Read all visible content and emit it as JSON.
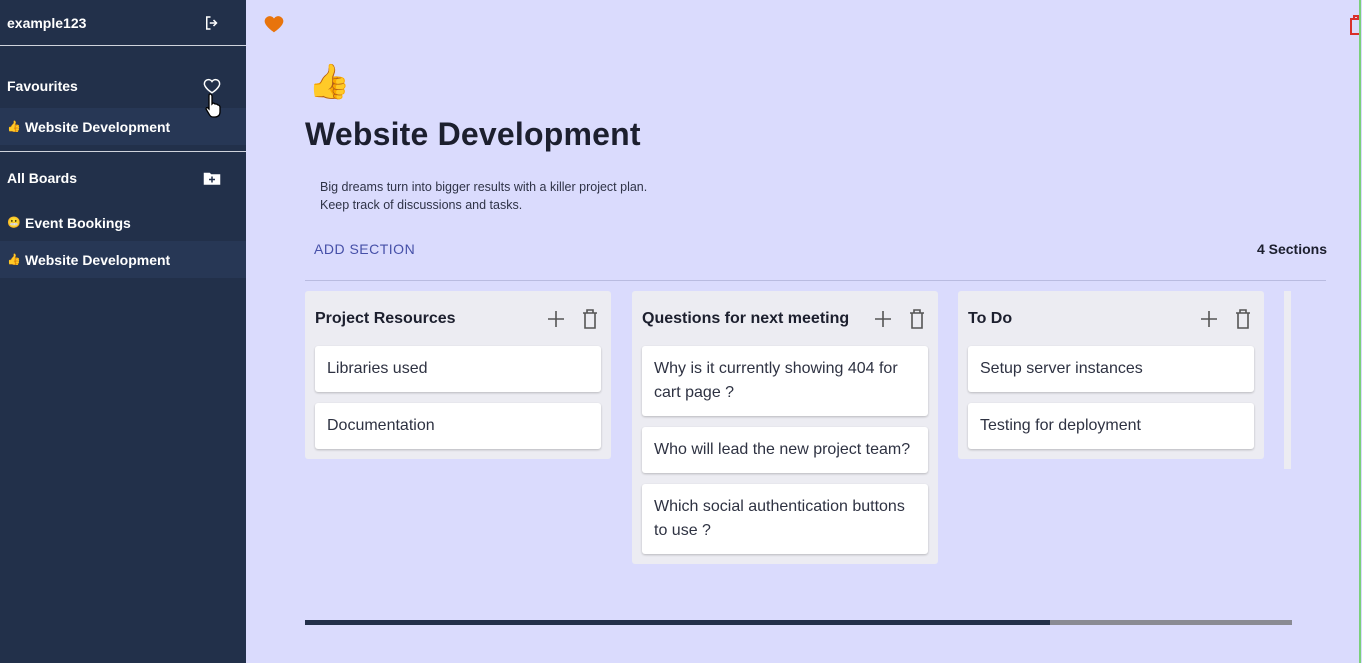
{
  "sidebar": {
    "username": "example123",
    "favourites_title": "Favourites",
    "favourites": [
      {
        "emoji": "👍",
        "label": "Website Development"
      }
    ],
    "all_boards_title": "All Boards",
    "boards": [
      {
        "emoji": "😬",
        "label": "Event Bookings"
      },
      {
        "emoji": "👍",
        "label": "Website Development"
      }
    ]
  },
  "board": {
    "emoji": "👍",
    "title": "Website Development",
    "description_line1": "Big dreams turn into bigger results with a killer project plan.",
    "description_line2": "Keep track of discussions and tasks.",
    "add_section_label": "ADD SECTION",
    "section_count_label": "4 Sections"
  },
  "sections": [
    {
      "title": "Project Resources",
      "cards": [
        "Libraries used",
        "Documentation"
      ]
    },
    {
      "title": "Questions for next meeting",
      "cards": [
        "Why is it currently showing 404 for cart page ?",
        "Who will lead the new project team?",
        "Which social authentication buttons to use ?"
      ]
    },
    {
      "title": "To Do",
      "cards": [
        "Setup server instances",
        "Testing for deployment"
      ]
    }
  ],
  "icons": {
    "logout": "logout-icon",
    "favourite_toggle": "heart-outline-icon",
    "add_board": "folder-add-icon",
    "favourite_filled": "heart-icon",
    "delete_board": "trash-icon",
    "add_card": "plus-icon",
    "delete_section": "trash-icon"
  },
  "colors": {
    "sidebar_bg": "#22304a",
    "main_bg": "#dadbfd",
    "accent": "#4650a8",
    "heart": "#e8740c",
    "danger": "#d9302b"
  }
}
